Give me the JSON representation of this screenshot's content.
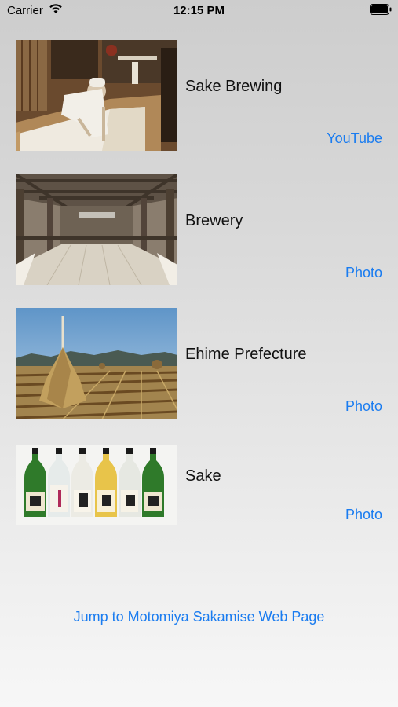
{
  "status_bar": {
    "carrier": "Carrier",
    "time": "12:15 PM"
  },
  "items": [
    {
      "title": "Sake Brewing",
      "link": "YouTube",
      "thumbnail": "sake-brewing-photo"
    },
    {
      "title": "Brewery",
      "link": "Photo",
      "thumbnail": "brewery-interior-photo"
    },
    {
      "title": "Ehime Prefecture",
      "link": "Photo",
      "thumbnail": "rice-field-photo"
    },
    {
      "title": "Sake",
      "link": "Photo",
      "thumbnail": "sake-bottles-photo"
    }
  ],
  "footer": {
    "jump_link": "Jump to Motomiya Sakamise Web Page"
  },
  "colors": {
    "link": "#1a7cf0",
    "background_top": "#cdcdcd",
    "background_bottom": "#f7f7f7"
  }
}
